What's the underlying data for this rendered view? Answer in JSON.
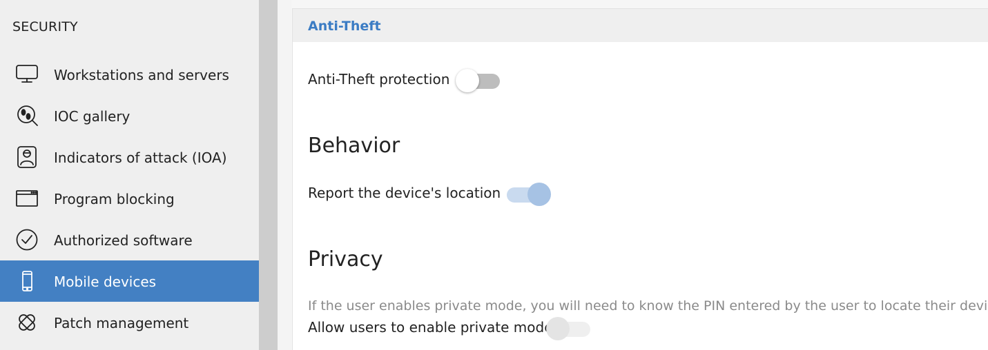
{
  "sidebar": {
    "heading": "SECURITY",
    "items": [
      {
        "label": "Workstations and servers",
        "icon": "monitor-icon"
      },
      {
        "label": "IOC gallery",
        "icon": "footprints-search-icon"
      },
      {
        "label": "Indicators of attack (IOA)",
        "icon": "hacker-badge-icon"
      },
      {
        "label": "Program blocking",
        "icon": "window-icon"
      },
      {
        "label": "Authorized software",
        "icon": "check-circle-icon"
      },
      {
        "label": "Mobile devices",
        "icon": "mobile-phone-icon",
        "active": true
      },
      {
        "label": "Patch management",
        "icon": "bandage-icon"
      }
    ]
  },
  "card": {
    "title": "Anti-Theft",
    "anti_theft": {
      "label": "Anti-Theft protection",
      "enabled": false
    },
    "behavior": {
      "heading": "Behavior",
      "report_location": {
        "label": "Report the device's location",
        "enabled": true
      }
    },
    "privacy": {
      "heading": "Privacy",
      "note": "If the user enables private mode, you will need to know the PIN entered by the user to locate their device.",
      "private_mode": {
        "label": "Allow users to enable private mode",
        "enabled": false,
        "disabled": true
      }
    }
  },
  "colors": {
    "accent": "#4380c3",
    "title": "#3b7cc4",
    "sidebar_bg": "#efefef"
  }
}
